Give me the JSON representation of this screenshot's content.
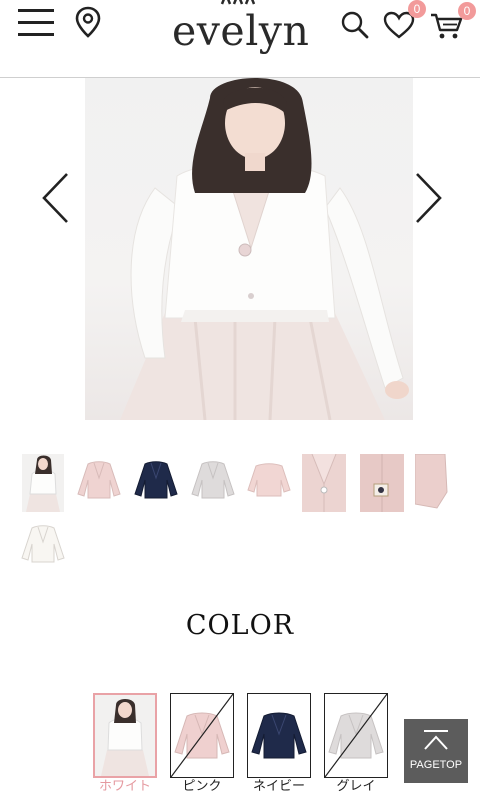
{
  "header": {
    "logo_text": "evelyn",
    "favorites_count": "0",
    "cart_count": "0",
    "icons": [
      "menu-icon",
      "map-pin-icon",
      "search-icon",
      "heart-icon",
      "cart-icon"
    ]
  },
  "gallery": {
    "thumbnail_count": 10,
    "selected_index": 0
  },
  "color": {
    "title": "COLOR",
    "options": [
      {
        "label": "ホワイト",
        "swatch": "#f7f5f3",
        "selected": true,
        "sold_out": false
      },
      {
        "label": "ピンク",
        "swatch": "#efcfcf",
        "selected": false,
        "sold_out": true
      },
      {
        "label": "ネイビー",
        "swatch": "#1f2a4a",
        "selected": false,
        "sold_out": false
      },
      {
        "label": "グレイ",
        "swatch": "#dcd9d8",
        "selected": false,
        "sold_out": true
      }
    ]
  },
  "pagetop": {
    "label": "PAGETOP"
  },
  "colors": {
    "badge": "#f29a9a",
    "selected_accent": "#e59aa0",
    "pagetop_bg": "#5c5c5c"
  }
}
